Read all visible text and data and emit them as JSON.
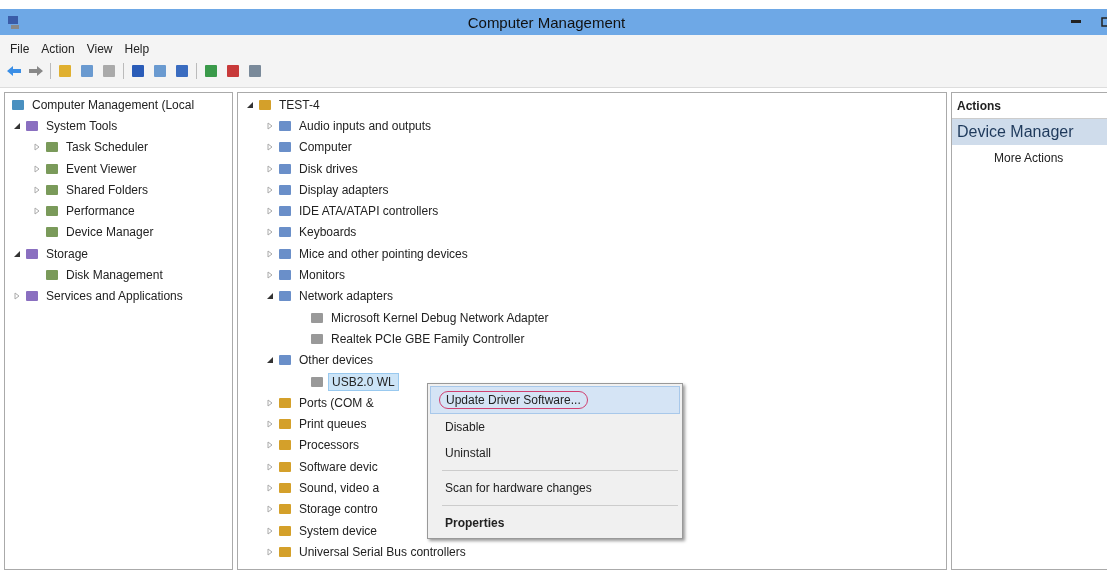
{
  "window": {
    "title": "Computer Management"
  },
  "menu": [
    "File",
    "Action",
    "View",
    "Help"
  ],
  "nav_tree": [
    {
      "label": "Computer Management (Local",
      "children": [
        {
          "label": "System Tools",
          "expanded": true,
          "children": [
            {
              "label": "Task Scheduler",
              "expanded": false
            },
            {
              "label": "Event Viewer",
              "expanded": false
            },
            {
              "label": "Shared Folders",
              "expanded": false
            },
            {
              "label": "Performance",
              "expanded": false
            },
            {
              "label": "Device Manager"
            }
          ]
        },
        {
          "label": "Storage",
          "expanded": true,
          "children": [
            {
              "label": "Disk Management"
            }
          ]
        },
        {
          "label": "Services and Applications",
          "expanded": false
        }
      ]
    }
  ],
  "device_tree": [
    {
      "label": "TEST-4",
      "expanded": true,
      "selected": false,
      "children": [
        {
          "label": "Audio inputs and outputs",
          "expanded": false,
          "selected": false
        },
        {
          "label": "Computer",
          "expanded": false,
          "selected": false
        },
        {
          "label": "Disk drives",
          "expanded": false,
          "selected": false
        },
        {
          "label": "Display adapters",
          "expanded": false,
          "selected": false
        },
        {
          "label": "IDE ATA/ATAPI controllers",
          "expanded": false,
          "selected": false
        },
        {
          "label": "Keyboards",
          "expanded": false,
          "selected": false
        },
        {
          "label": "Mice and other pointing devices",
          "expanded": false,
          "selected": false
        },
        {
          "label": "Monitors",
          "expanded": false,
          "selected": false
        },
        {
          "label": "Network adapters",
          "expanded": true,
          "selected": false,
          "children": [
            {
              "label": "Microsoft Kernel Debug Network Adapter",
              "selected": false
            },
            {
              "label": "Realtek PCIe GBE Family Controller",
              "selected": false
            }
          ]
        },
        {
          "label": "Other devices",
          "expanded": true,
          "selected": false,
          "children": [
            {
              "label": "USB2.0 WL",
              "selected": true
            }
          ]
        },
        {
          "label": "Ports (COM &",
          "expanded": false,
          "selected": false
        },
        {
          "label": "Print queues",
          "expanded": false,
          "selected": false
        },
        {
          "label": "Processors",
          "expanded": false,
          "selected": false
        },
        {
          "label": "Software devic",
          "expanded": false,
          "selected": false
        },
        {
          "label": "Sound, video a",
          "expanded": false,
          "selected": false
        },
        {
          "label": "Storage contro",
          "expanded": false,
          "selected": false
        },
        {
          "label": "System device",
          "expanded": false,
          "selected": false
        },
        {
          "label": "Universal Serial Bus controllers",
          "expanded": false,
          "selected": false
        }
      ]
    }
  ],
  "context_menu": [
    {
      "kind": "item",
      "label": "Update Driver Software...",
      "selected": true,
      "circled": true,
      "default": false
    },
    {
      "kind": "item",
      "label": "Disable",
      "selected": false,
      "circled": false,
      "default": false
    },
    {
      "kind": "item",
      "label": "Uninstall",
      "selected": false,
      "circled": false,
      "default": false
    },
    {
      "kind": "separator"
    },
    {
      "kind": "item",
      "label": "Scan for hardware changes",
      "selected": false,
      "circled": false,
      "default": false
    },
    {
      "kind": "separator"
    },
    {
      "kind": "item",
      "label": "Properties",
      "selected": false,
      "circled": false,
      "default": true
    }
  ],
  "actions": {
    "header": "Actions",
    "section": "Device Manager",
    "items": [
      "More Actions"
    ]
  }
}
